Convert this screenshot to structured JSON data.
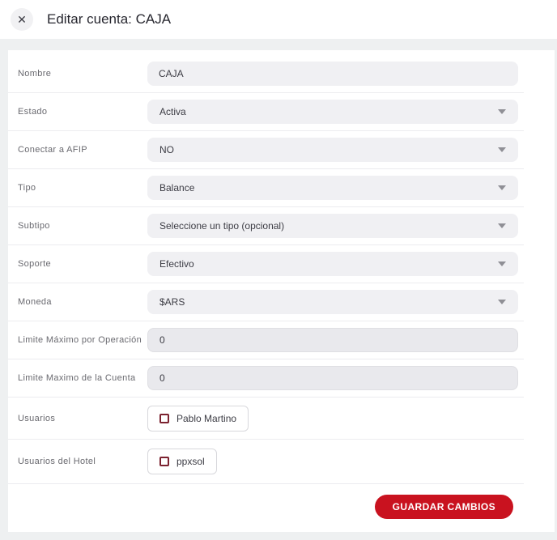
{
  "header": {
    "title": "Editar cuenta: CAJA",
    "close_icon": "✕"
  },
  "form": {
    "rows": [
      {
        "label": "Nombre",
        "type": "text",
        "value": "CAJA"
      },
      {
        "label": "Estado",
        "type": "select",
        "value": "Activa"
      },
      {
        "label": "Conectar a AFIP",
        "type": "select",
        "value": "NO"
      },
      {
        "label": "Tipo",
        "type": "select",
        "value": "Balance"
      },
      {
        "label": "Subtipo",
        "type": "select",
        "value": "Seleccione un tipo (opcional)"
      },
      {
        "label": "Soporte",
        "type": "select",
        "value": "Efectivo"
      },
      {
        "label": "Moneda",
        "type": "select",
        "value": "$ARS"
      },
      {
        "label": "Limite Máximo por Operación",
        "type": "number",
        "value": "0"
      },
      {
        "label": "Limite Maximo de la Cuenta",
        "type": "number",
        "value": "0"
      },
      {
        "label": "Usuarios",
        "type": "checkbox",
        "value": "Pablo Martino",
        "checked": false
      },
      {
        "label": "Usuarios del Hotel",
        "type": "checkbox",
        "value": "ppxsol",
        "checked": false
      }
    ],
    "submit_label": "GUARDAR CAMBIOS"
  },
  "colors": {
    "accent_red": "#c9121f",
    "checkbox_border": "#7c2230",
    "input_background": "#f0f0f3",
    "page_background": "#eef0f1"
  }
}
